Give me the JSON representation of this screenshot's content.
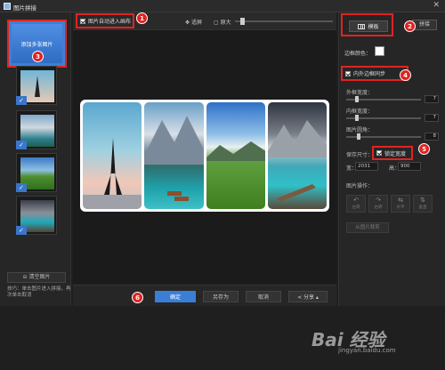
{
  "window": {
    "title": "图片拼接",
    "close_glyph": "✕"
  },
  "left_panel": {
    "add_button_label": "添加多张图片",
    "clear_button_label": "清空图片",
    "tip": "技巧：单击图片进入拼接，再次单击取消",
    "thumbnails": [
      {
        "subject": "eiffel-tower",
        "checked": true
      },
      {
        "subject": "mountain-lake",
        "checked": true
      },
      {
        "subject": "green-valley",
        "checked": true
      },
      {
        "subject": "glacier-lake",
        "checked": true
      }
    ]
  },
  "toolbar": {
    "auto_add_label": "图片自动进入画布",
    "auto_add_checked": true,
    "fit_label": "适屏",
    "zoom_label": "原大"
  },
  "bottom_bar": {
    "confirm_label": "确定",
    "save_as_label": "另存为",
    "cancel_label": "取消",
    "share_label": "分享"
  },
  "right_panel": {
    "layout_label": "模板",
    "splice_label": "拼接",
    "bg_color_label": "边框颜色：",
    "bg_color": "#ffffff",
    "sync_label": "内外边框同步",
    "outer_border_label": "外框宽度：",
    "outer_border_value": "7",
    "inner_border_label": "内框宽度：",
    "inner_border_value": "7",
    "radius_label": "图片圆角：",
    "radius_value": "8",
    "size_label": "保存尺寸：",
    "lock_label": "锁定宽度",
    "lock_checked": true,
    "width_label": "宽：",
    "width_value": "2031",
    "height_label": "高：",
    "height_value": "900",
    "ops_label": "图片操作：",
    "ops": [
      {
        "glyph": "↶",
        "label": "左转"
      },
      {
        "glyph": "↷",
        "label": "右转"
      },
      {
        "glyph": "⇆",
        "label": "水平"
      },
      {
        "glyph": "⇅",
        "label": "垂直"
      }
    ],
    "more_label": "从图片裁剪"
  },
  "callouts": [
    "1",
    "2",
    "3",
    "4",
    "5",
    "6"
  ],
  "watermark": {
    "logo": "Bai 经验",
    "url": "jingyan.baidu.com"
  },
  "colors": {
    "accent": "#3a7fd5",
    "highlight": "#e02323",
    "panel": "#262626"
  }
}
